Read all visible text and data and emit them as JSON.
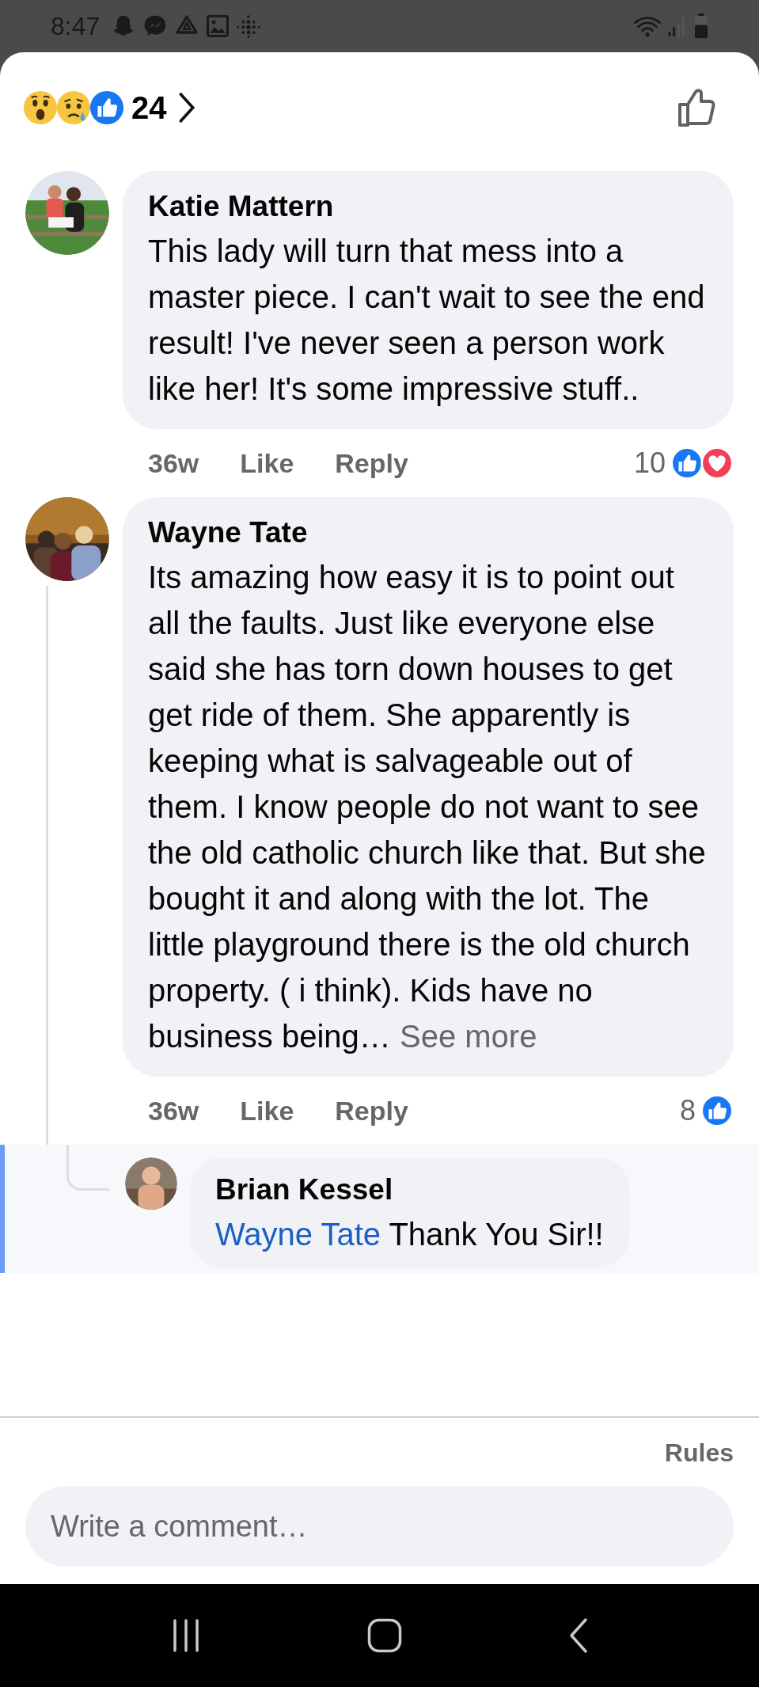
{
  "status_bar": {
    "time": "8:47"
  },
  "reactions_summary": {
    "reactions": [
      {
        "kind": "wow"
      },
      {
        "kind": "sad"
      },
      {
        "kind": "like"
      }
    ],
    "count": "24"
  },
  "comments": [
    {
      "author": "Katie Mattern",
      "text": "This lady will turn that mess into a master piece. I can't wait to see the end result! I've never seen a person work like her! It's some impressive stuff..",
      "time": "36w",
      "actions": [
        "Like",
        "Reply"
      ],
      "reaction_count": "10",
      "reactions": [
        {
          "kind": "like"
        },
        {
          "kind": "love"
        }
      ]
    },
    {
      "author": "Wayne Tate",
      "text": "Its amazing how easy it is to point out all the faults. Just like everyone else said she has torn down houses to get get ride of them. She apparently is keeping what is salvageable out of them. I know people do not want to see the old catholic church like that. But she bought it and along with the lot. The little playground there is the old church property. ( i think). Kids have no business being…",
      "see_more": "See more",
      "time": "36w",
      "actions": [
        "Like",
        "Reply"
      ],
      "reaction_count": "8",
      "reactions": [
        {
          "kind": "like"
        }
      ],
      "replies": [
        {
          "author": "Brian Kessel",
          "mention": "Wayne Tate",
          "text": "Thank You Sir!!",
          "highlighted": true
        }
      ]
    }
  ],
  "rules_link": "Rules",
  "composer": {
    "placeholder": "Write a comment…"
  }
}
